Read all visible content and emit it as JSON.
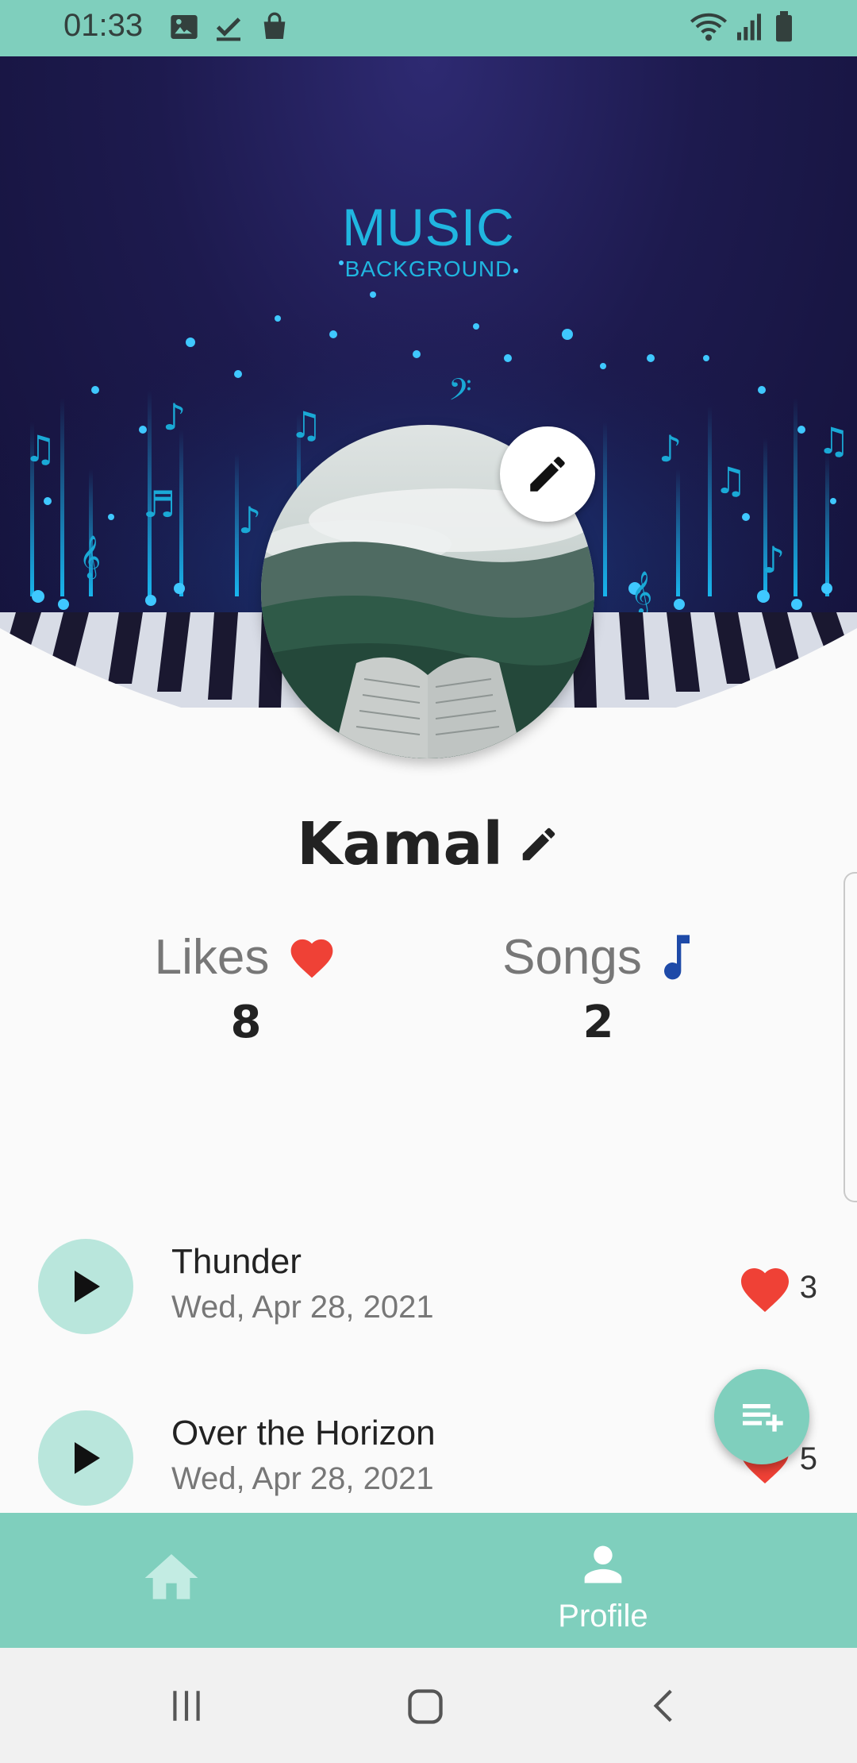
{
  "status_bar": {
    "time": "01:33",
    "icons": [
      "image-icon",
      "download-done-icon",
      "shopping-bag-icon",
      "wifi-icon",
      "signal-icon",
      "battery-icon"
    ]
  },
  "hero": {
    "title": "MUSIC",
    "subtitle": "BACKGROUND"
  },
  "profile": {
    "name": "Kamal",
    "likes_label": "Likes",
    "likes_value": "8",
    "songs_label": "Songs",
    "songs_value": "2"
  },
  "songs": [
    {
      "title": "Thunder",
      "date": "Wed, Apr 28, 2021",
      "likes": "3"
    },
    {
      "title": "Over the Horizon",
      "date": "Wed, Apr 28, 2021",
      "likes": "5"
    }
  ],
  "bottom_nav": {
    "home_icon": "home-icon",
    "profile_label": "Profile"
  },
  "colors": {
    "accent": "#7fcfbd",
    "play_bg": "#b9e6dc",
    "heart": "#ef4136",
    "note": "#1e4aa8"
  }
}
